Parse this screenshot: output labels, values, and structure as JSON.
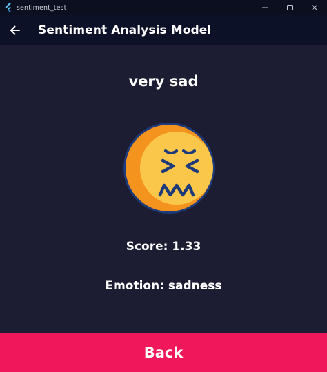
{
  "window": {
    "title": "sentiment_test",
    "icon": "flutter-logo-icon",
    "controls": [
      "minimize-icon",
      "maximize-icon",
      "close-icon"
    ]
  },
  "appbar": {
    "title": "Sentiment Analysis Model",
    "back_icon": "arrow-left-icon"
  },
  "result": {
    "label": "very sad",
    "emoji_icon": "confounded-face-icon",
    "score_text": "Score: 1.33",
    "emotion_text": "Emotion: sadness"
  },
  "footer": {
    "back_label": "Back"
  },
  "colors": {
    "background": "#1c1c33",
    "appbar": "#0d1128",
    "titlebar": "#0b0f1f",
    "button": "#f0185a",
    "emoji_face": "#fbc74a",
    "emoji_shadow": "#f5931f",
    "emoji_outline": "#1d3b7a"
  }
}
